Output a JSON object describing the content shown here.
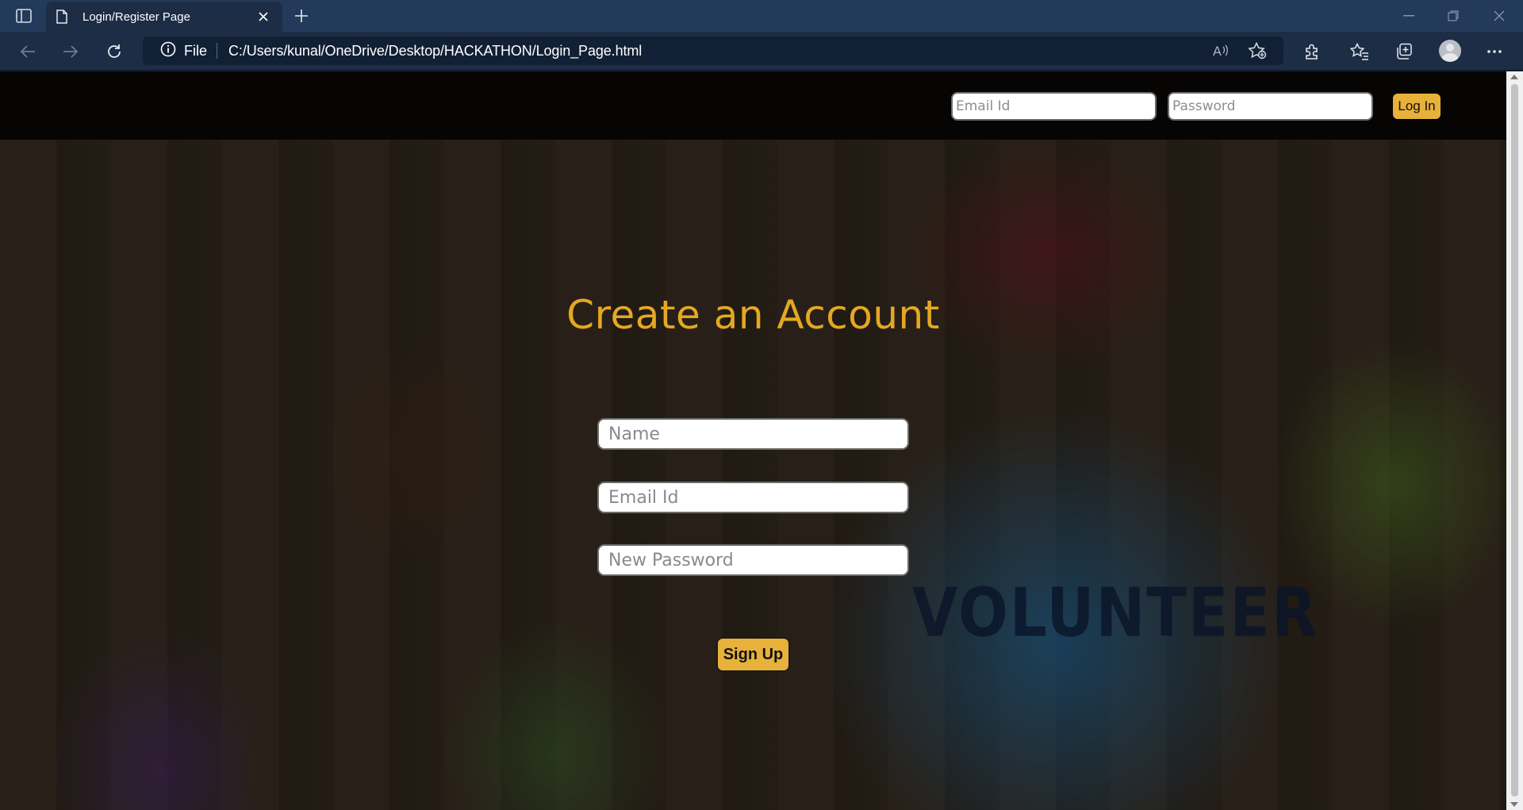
{
  "browser": {
    "tab": {
      "title": "Login/Register Page"
    },
    "address": {
      "scheme_label": "File",
      "url": "C:/Users/kunal/OneDrive/Desktop/HACKATHON/Login_Page.html"
    },
    "icons": [
      "tab-actions-icon",
      "page-icon",
      "close-icon",
      "plus-icon",
      "minimize-icon",
      "restore-icon",
      "window-close-icon",
      "back-icon",
      "forward-icon",
      "refresh-icon",
      "info-icon",
      "read-aloud-icon",
      "add-favorite-icon",
      "extensions-icon",
      "favorites-icon",
      "collections-icon",
      "profile-icon",
      "more-icon"
    ]
  },
  "header": {
    "email_placeholder": "Email Id",
    "password_placeholder": "Password",
    "login_label": "Log In"
  },
  "form": {
    "title": "Create an Account",
    "name_placeholder": "Name",
    "email_placeholder": "Email Id",
    "password_placeholder": "New Password",
    "signup_label": "Sign Up"
  },
  "background": {
    "vest_text": "VOLUNTEER"
  },
  "colors": {
    "accent": "#e7b13a",
    "title": "#e5a822",
    "header_bg": "#060504",
    "chrome": "#1c2d45"
  }
}
